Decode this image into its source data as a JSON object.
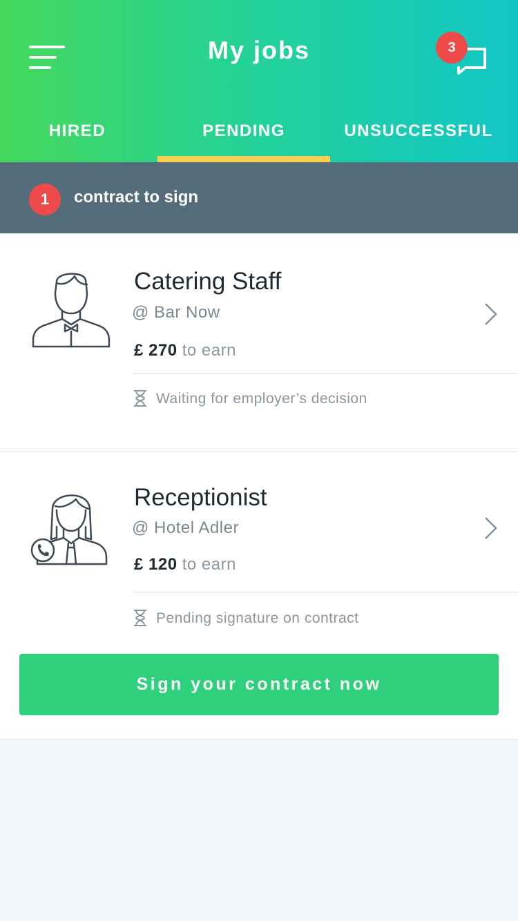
{
  "header": {
    "title": "My jobs",
    "chat_badge_count": "3",
    "menu_icon": "hamburger-menu-icon",
    "chat_icon": "chat-bubble-icon"
  },
  "tabs": [
    {
      "label": "HIRED"
    },
    {
      "label": "PENDING"
    },
    {
      "label": "UNSUCCESSFUL"
    }
  ],
  "active_tab": "PENDING",
  "notice": {
    "count": "1",
    "text": "contract to sign"
  },
  "jobs": [
    {
      "title": "Catering Staff",
      "company": "@ Bar Now",
      "amount": "£ 270",
      "earn_suffix": "to earn",
      "status": "Waiting for employer’s decision",
      "avatar_icon": "waiter-avatar-icon"
    },
    {
      "title": "Receptionist",
      "company": "@ Hotel Adler",
      "amount": "£ 120",
      "earn_suffix": "to earn",
      "status": "Pending signature on contract",
      "avatar_icon": "receptionist-avatar-icon",
      "cta_label": "Sign your contract now"
    }
  ],
  "colors": {
    "gradient_start": "#45d85c",
    "gradient_end": "#12c6c6",
    "tab_indicator": "#f7cf52",
    "badge": "#ef4a4a",
    "notice_bar": "#546c79",
    "cta": "#2fd07c"
  }
}
